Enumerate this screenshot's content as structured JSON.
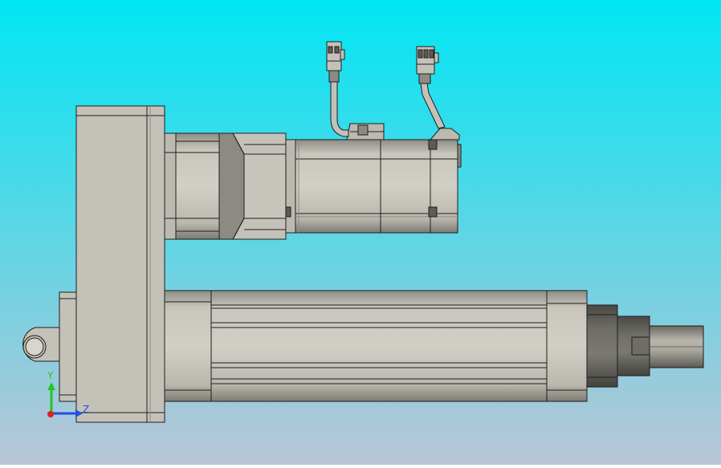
{
  "viewport": {
    "background_top": "#00e6f4",
    "background_bottom": "#bac5d6"
  },
  "model": {
    "parts": [
      "mounting-clevis",
      "gear-housing",
      "motor-adapter",
      "motor-gearbox",
      "servo-motor",
      "encoder-connector",
      "power-connector",
      "actuator-body",
      "rod-end-collar",
      "piston-rod"
    ],
    "colors": {
      "body": "#c4c2b8",
      "shade": "#8c8a82",
      "dark": "#5c5b56",
      "edge": "#1e1e1e"
    }
  },
  "triad": {
    "y_label": "Y",
    "z_label": "Z",
    "y_color": "#22c722",
    "z_color": "#2050e0",
    "x_color": "#e02020"
  }
}
